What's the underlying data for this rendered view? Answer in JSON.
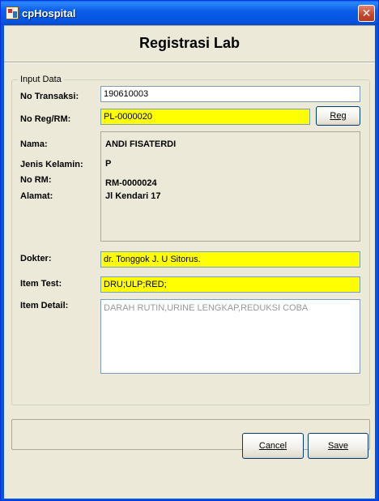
{
  "window": {
    "title": "cpHospital",
    "close_glyph": "✕"
  },
  "header": {
    "title": "Registrasi Lab"
  },
  "group": {
    "legend": "Input Data"
  },
  "form": {
    "no_transaksi_label": "No Transaksi:",
    "no_transaksi_value": "190610003",
    "no_reg_label": "No Reg/RM:",
    "no_reg_value": "PL-0000020",
    "reg_button": "Reg",
    "nama_label": "Nama:",
    "nama_value": "ANDI FISATERDI",
    "jenis_kelamin_label": "Jenis Kelamin:",
    "jenis_kelamin_value": "P",
    "no_rm_label": "No RM:",
    "no_rm_value": "RM-0000024",
    "alamat_label": "Alamat:",
    "alamat_value": "Jl Kendari 17",
    "dokter_label": "Dokter:",
    "dokter_value": "dr. Tonggok J. U Sitorus.",
    "item_test_label": "Item Test:",
    "item_test_value": "DRU;ULP;RED;",
    "item_detail_label": "Item Detail:",
    "item_detail_value": "DARAH RUTIN,URINE LENGKAP,REDUKSI COBA"
  },
  "actions": {
    "cancel": "Cancel",
    "save": "Save"
  },
  "colors": {
    "titlebar": "#0055E5",
    "highlight_field": "#FFFF00",
    "background": "#ECE9D8"
  }
}
